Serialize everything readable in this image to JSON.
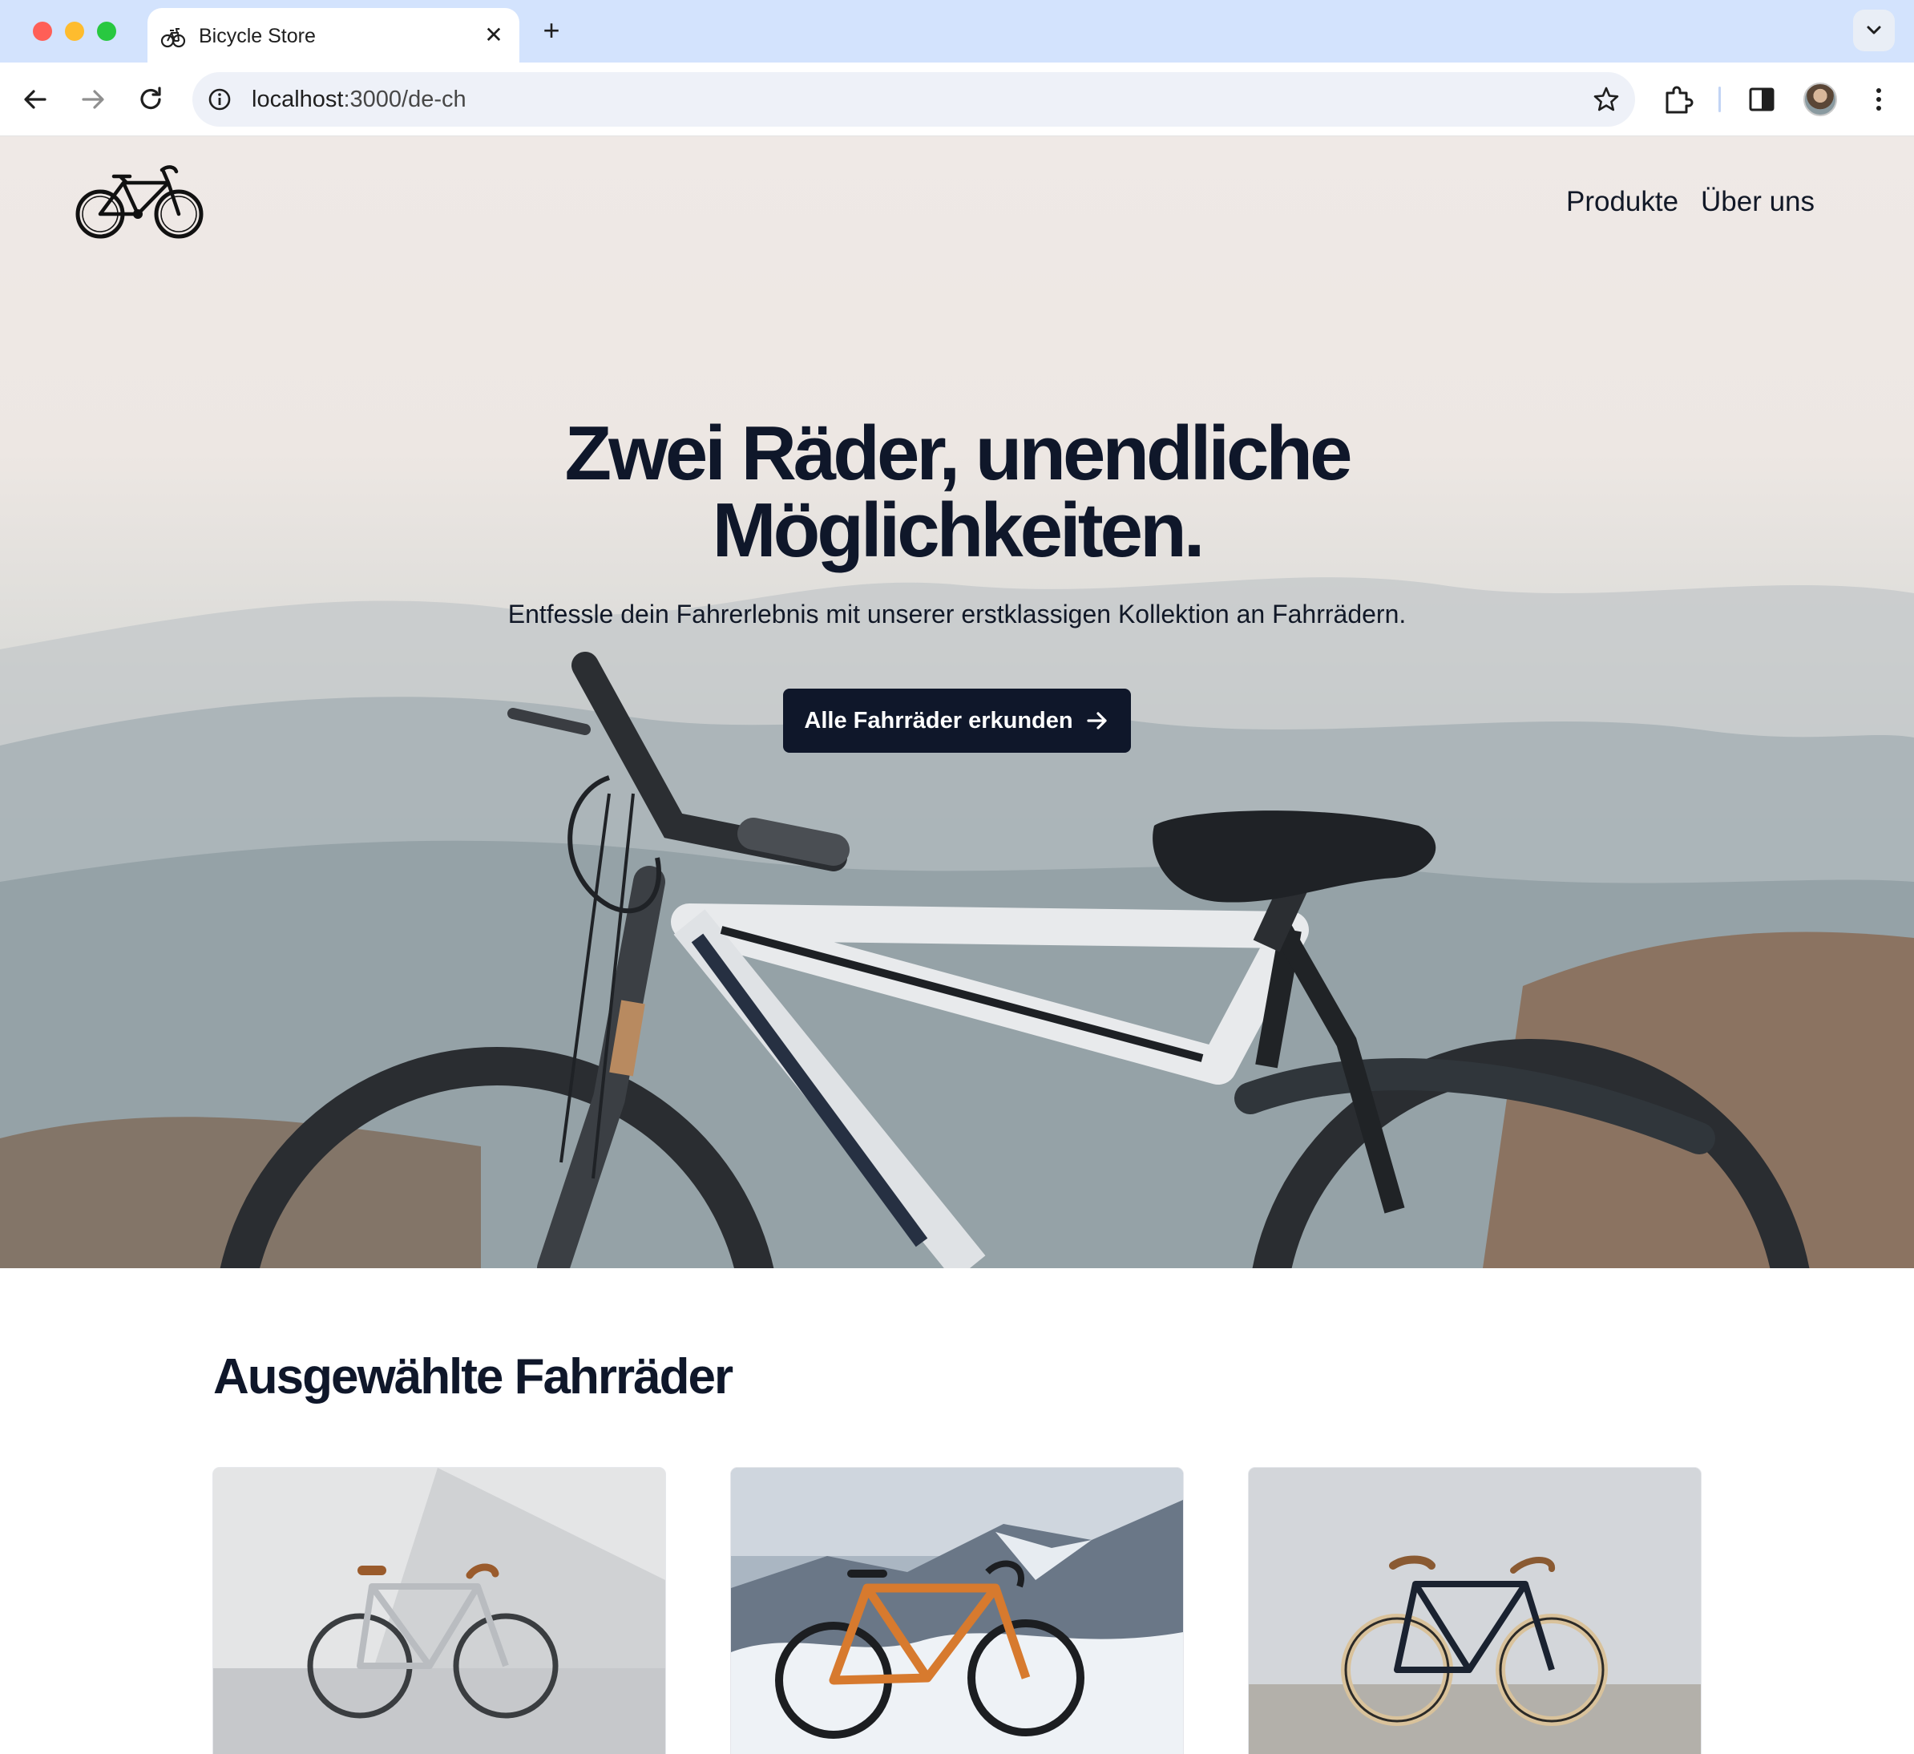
{
  "browser": {
    "tab_title": "Bicycle Store",
    "url_host": "localhost",
    "url_path": ":3000/de-ch"
  },
  "site": {
    "nav": [
      {
        "label": "Produkte"
      },
      {
        "label": "Über uns"
      }
    ],
    "hero": {
      "title_line1": "Zwei Räder, unendliche",
      "title_line2": "Möglichkeiten.",
      "subtitle": "Entfessle dein Fahrerlebnis mit unserer erstklassigen Kollektion an Fahrrädern.",
      "cta_label": "Alle Fahrräder erkunden"
    },
    "featured": {
      "title": "Ausgewählte Fahrräder",
      "cards": [
        {
          "image": "silver-fixie-bicycle"
        },
        {
          "image": "orange-gravel-bicycle-in-snow"
        },
        {
          "image": "black-single-speed-bicycle"
        }
      ]
    }
  },
  "colors": {
    "primary": "#0f172a",
    "tabbar": "#d3e3fd"
  },
  "icons": [
    "bicycle-favicon-icon",
    "close-icon",
    "plus-icon",
    "chevron-down-icon",
    "back-icon",
    "forward-icon",
    "reload-icon",
    "info-icon",
    "star-icon",
    "extensions-icon",
    "side-panel-icon",
    "more-icon",
    "arrow-right-icon",
    "bicycle-logo-icon"
  ]
}
